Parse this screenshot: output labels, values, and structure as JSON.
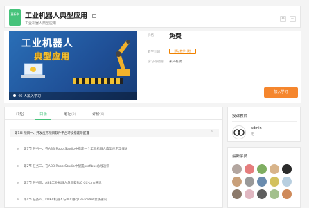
{
  "header": {
    "badge": "更新中",
    "title": "工业机器人典型应用",
    "subtitle": "工业机器人典型应用",
    "btn_a": "⊕",
    "btn_b": "⋯"
  },
  "intro": {
    "cover_title_1": "工业机器人",
    "cover_title_2": "典型应用",
    "cover_learners": "46 人加入学习",
    "price_label": "价格",
    "price": "免费",
    "plan_label": "教学计划",
    "plan_value": "默认教学计划",
    "valid_label": "学习有效期",
    "valid_value": "永久有效",
    "join_button": "加入学习"
  },
  "tabs": [
    {
      "label": "介绍"
    },
    {
      "label": "目录"
    },
    {
      "label": "笔记",
      "count": "(0)"
    },
    {
      "label": "评价",
      "count": "(0)"
    }
  ],
  "chapter": {
    "label": "第1章 项目一、开发应用项目软件平台环境搭建与配置",
    "arrow": "⌃"
  },
  "lessons": [
    "第1节 任务一、在ABB RobotStudio中搭建一个工业机器人典型应用工作站",
    "第2节 任务二、在ABB RobotStudio中配置profibus总线通讯",
    "第3节 任务三、ABB工业机器人与三菱PLC CC-Link通讯",
    "第4节 任务四、KUKA机器人与PLC进行DeviceNet总线通讯"
  ],
  "sidebar": {
    "teacher_title": "授课教师",
    "teacher_name": "admin",
    "teacher_role": "无",
    "students_title": "最新学员"
  },
  "colors": {
    "accent": "#46c37b",
    "orange": "#f5862d"
  }
}
